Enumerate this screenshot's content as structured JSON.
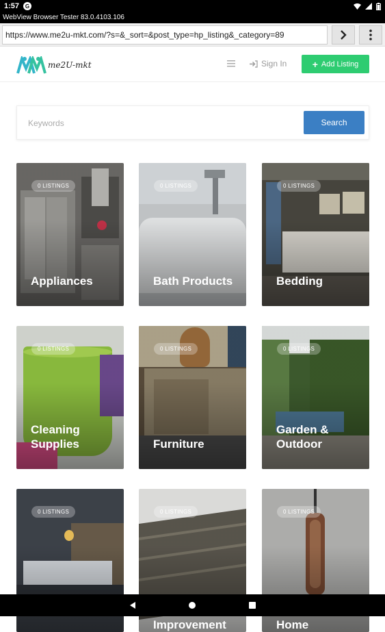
{
  "status": {
    "time": "1:57",
    "badge": "G"
  },
  "app": {
    "title": "WebView Browser Tester 83.0.4103.106"
  },
  "browser": {
    "url": "https://www.me2u-mkt.com/?s=&_sort=&post_type=hp_listing&_category=89",
    "go_icon": "chevron-right-icon",
    "menu_icon": "more-vertical-icon"
  },
  "header": {
    "logo_text": "me2U-mkt",
    "menu_icon": "hamburger-icon",
    "signin_label": "Sign In",
    "add_listing_label": "Add Listing",
    "accent": "#2ecc71"
  },
  "search": {
    "placeholder": "Keywords",
    "button_label": "Search",
    "button_color": "#3b7fc4"
  },
  "categories": [
    {
      "name": "Appliances",
      "count": "0 LISTINGS",
      "color": "#6d6b68"
    },
    {
      "name": "Bath Products",
      "count": "0 LISTINGS",
      "color": "#bfc3c6"
    },
    {
      "name": "Bedding",
      "count": "0 LISTINGS",
      "color": "#5a5548"
    },
    {
      "name": "Cleaning Supplies",
      "count": "0 LISTINGS",
      "color": "#8fc240"
    },
    {
      "name": "Furniture",
      "count": "0 LISTINGS",
      "color": "#6b5a44"
    },
    {
      "name": "Garden & Outdoor",
      "count": "0 LISTINGS",
      "color": "#4d6b3a"
    },
    {
      "name": "",
      "count": "0 LISTINGS",
      "color": "#4a4f57"
    },
    {
      "name": "Home Improvement",
      "count": "0 LISTINGS",
      "color": "#5c584f"
    },
    {
      "name": "Home",
      "count": "0 LISTINGS",
      "color": "#9c9c9a"
    }
  ]
}
